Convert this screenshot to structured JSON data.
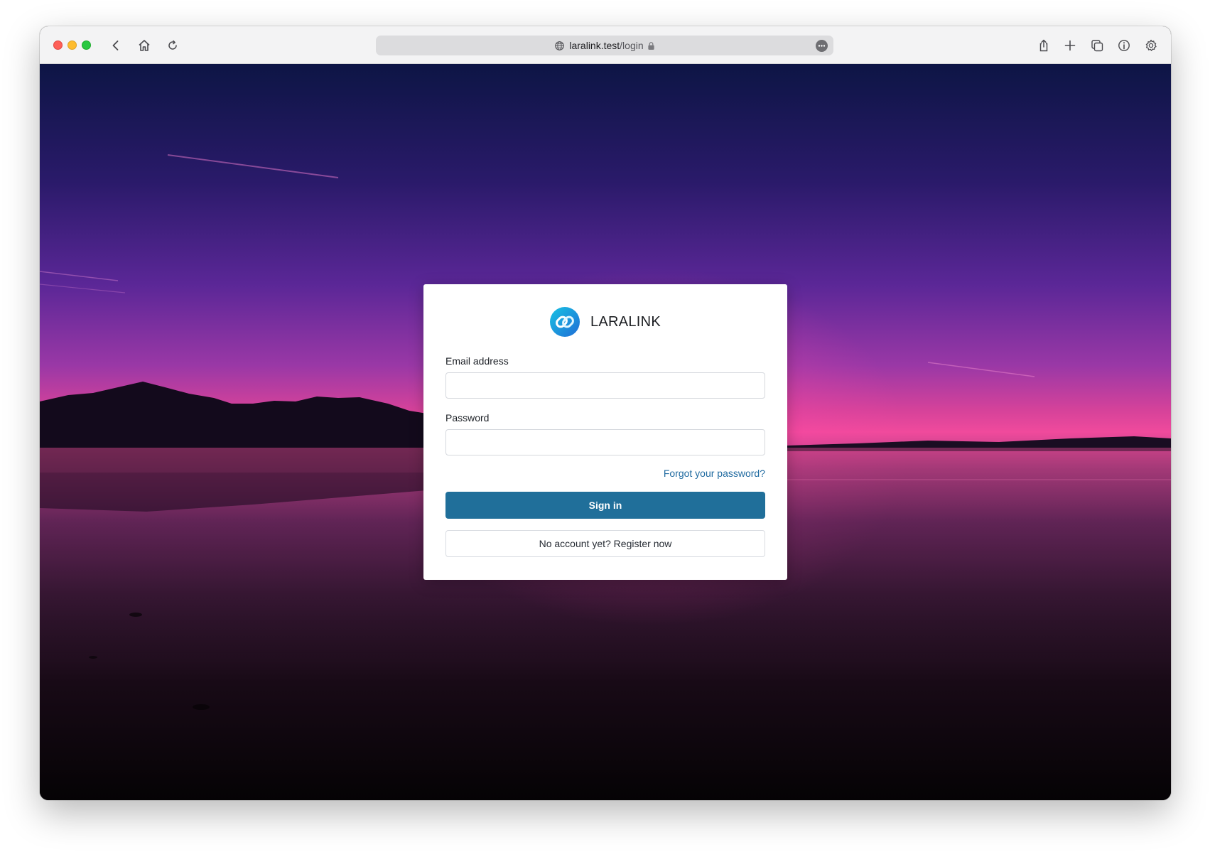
{
  "browser": {
    "url_host": "laralink.test",
    "url_path": "/login",
    "icons": [
      "back-icon",
      "home-icon",
      "reload-icon",
      "globe-icon",
      "lock-icon",
      "more-icon",
      "share-icon",
      "new-tab-icon",
      "tabs-icon",
      "info-icon",
      "gear-icon"
    ]
  },
  "login": {
    "brand_name": "LARALINK",
    "email_label": "Email address",
    "email_value": "",
    "password_label": "Password",
    "password_value": "",
    "forgot_link": "Forgot your password?",
    "signin_label": "Sign in",
    "register_label": "No account yet? Register now"
  },
  "colors": {
    "primary": "#206f9a",
    "link": "#1f6aa0",
    "logo_gradient_start": "#18c2e3",
    "logo_gradient_end": "#1f6dd6"
  }
}
